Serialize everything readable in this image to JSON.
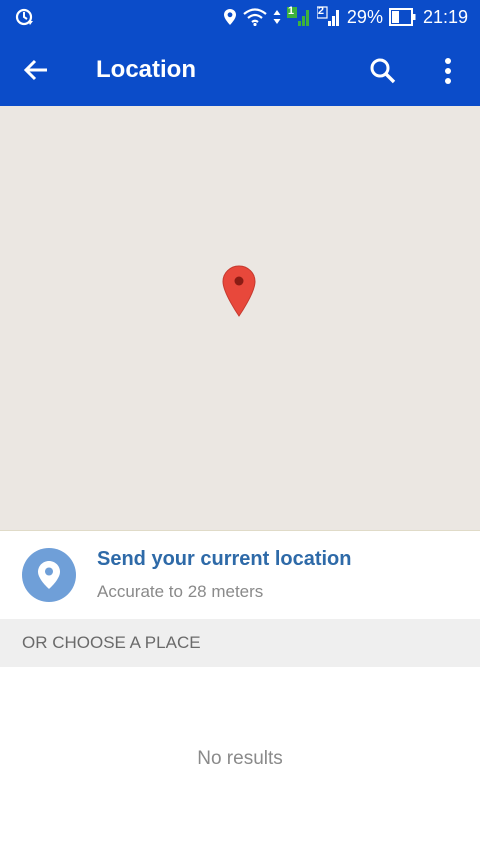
{
  "status_bar": {
    "battery": "29%",
    "time": "21:19",
    "sim1": "1",
    "sim2": "2",
    "icons": [
      "sync-icon",
      "location-icon",
      "wifi-icon",
      "data-arrows-icon",
      "signal-icon",
      "signal-icon",
      "battery-icon"
    ]
  },
  "app_bar": {
    "title": "Location",
    "back_icon": "arrow-back-icon",
    "search_icon": "search-icon",
    "more_icon": "more-vert-icon"
  },
  "map": {
    "pin_icon": "map-pin-icon"
  },
  "current_location": {
    "title": "Send your current location",
    "subtitle": "Accurate to 28 meters",
    "icon": "location-pin-icon"
  },
  "places": {
    "header": "OR CHOOSE A PLACE",
    "empty_text": "No results"
  },
  "colors": {
    "primary": "#0b4cc9",
    "map_bg": "#ebe7e2",
    "accent_text": "#2e6aa8",
    "pin_red": "#e8483b",
    "location_circle": "#6f9fd8"
  }
}
